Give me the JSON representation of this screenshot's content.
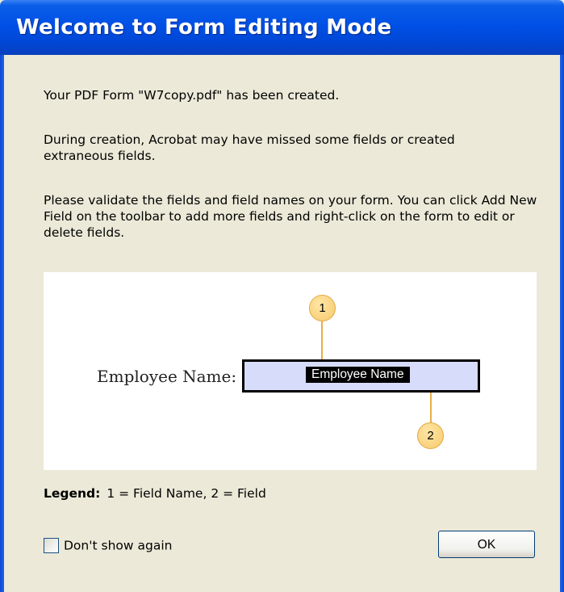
{
  "window": {
    "title": "Welcome to Form Editing Mode"
  },
  "message": {
    "line1": "Your PDF Form \"W7copy.pdf\" has been created.",
    "line2": "During creation, Acrobat may have missed some fields or created extraneous fields.",
    "line3": "Please validate the fields and field names on your form. You can click Add New Field on the toolbar to add more fields and right-click on the form to edit or delete fields."
  },
  "preview": {
    "label": "Employee Name:",
    "field_name": "Employee Name",
    "callout_1": "1",
    "callout_2": "2"
  },
  "legend": {
    "label": "Legend:",
    "text": "1 = Field Name, 2 = Field"
  },
  "footer": {
    "checkbox_label": "Don't show again",
    "checkbox_checked": false,
    "ok_label": "OK"
  },
  "colors": {
    "titlebar": "#0050e6",
    "dialog_bg": "#ece9d8",
    "field_fill": "#d7dcfb",
    "callout": "#f7c96a"
  }
}
